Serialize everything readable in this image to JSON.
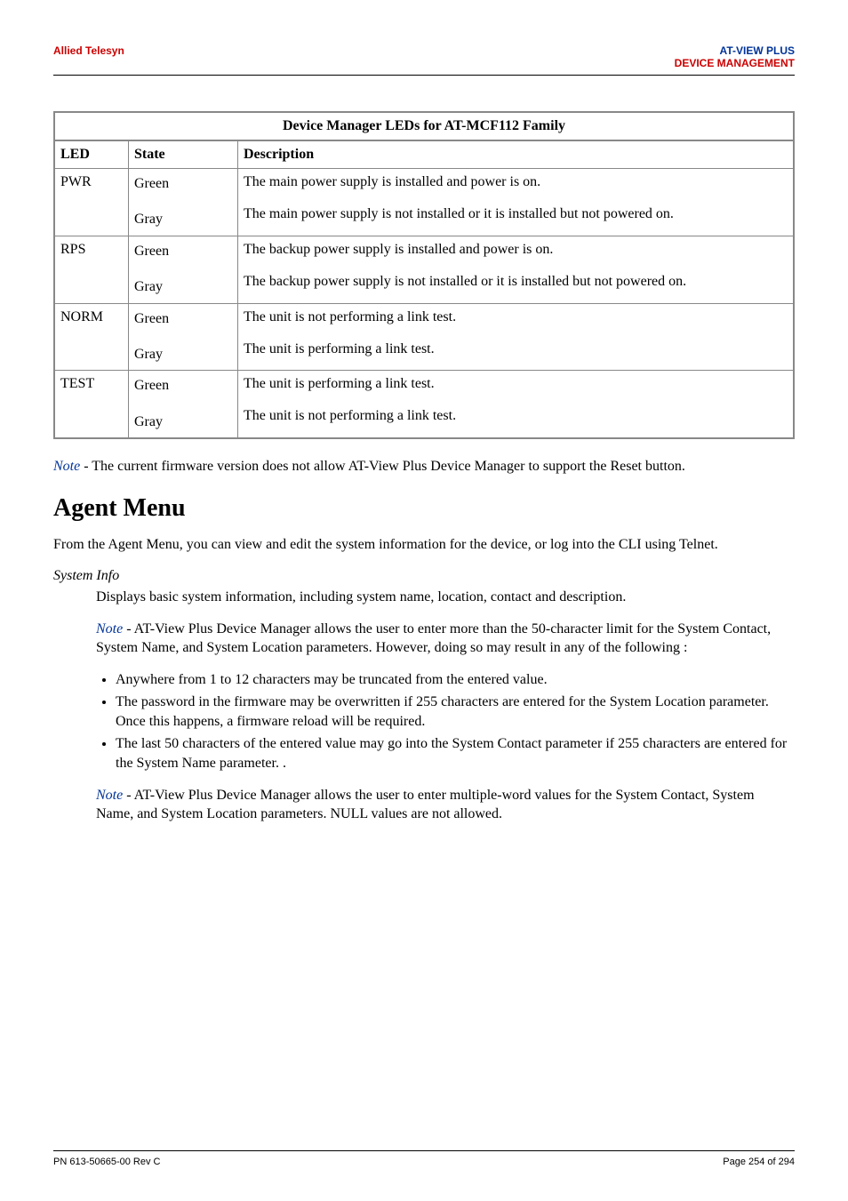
{
  "header": {
    "left": "Allied Telesyn",
    "right_line1": "AT-VIEW PLUS",
    "right_line2": "DEVICE MANAGEMENT"
  },
  "table": {
    "caption": "Device Manager LEDs for AT-MCF112 Family",
    "headers": {
      "led": "LED",
      "state": "State",
      "description": "Description"
    },
    "rows": [
      {
        "led": "PWR",
        "state1": "Green",
        "state2": "Gray",
        "desc1": "The main power supply is installed and power is on.",
        "desc2": "The main power supply is not installed or it is installed but not powered on."
      },
      {
        "led": "RPS",
        "state1": "Green",
        "state2": "Gray",
        "desc1": "The backup power supply is installed and power is on.",
        "desc2": "The backup power supply is not installed or it is installed but not powered on."
      },
      {
        "led": "NORM",
        "state1": "Green",
        "state2": "Gray",
        "desc1": "The unit is not performing a link test.",
        "desc2": "The unit is performing a link test."
      },
      {
        "led": "TEST",
        "state1": "Green",
        "state2": "Gray",
        "desc1": "The unit is performing a link test.",
        "desc2": "The unit is not performing a link test."
      }
    ]
  },
  "note1_prefix": "Note",
  "note1_rest": " - The current firmware version does not allow AT-View Plus Device Manager to support the Reset button.",
  "agent_heading": "Agent Menu",
  "agent_p1": "From the Agent Menu, you can view and edit the system information for the device, or log into the CLI using Telnet.",
  "sysinfo_label": "System Info",
  "sysinfo_p1": "Displays basic system information, including system name, location, contact and description.",
  "note2_prefix": "Note",
  "note2_rest": " - AT-View Plus Device Manager allows the user to enter more than the 50-character limit for the System Contact, System Name, and System Location parameters. However, doing so may result in any of the following :",
  "bullets": [
    "Anywhere from 1 to 12 characters may be truncated from the entered value.",
    "The password in the firmware may be overwritten if 255 characters are entered for the System Location parameter. Once this happens, a firmware reload will be required.",
    "The last 50 characters of the entered value may go into the System Contact parameter if 255 characters are entered for the System Name parameter. ."
  ],
  "note3_prefix": "Note",
  "note3_rest": " - AT-View Plus Device Manager allows the user to enter multiple-word values for the System Contact, System Name, and System Location parameters. NULL values are not allowed.",
  "footer": {
    "left": "PN 613-50665-00 Rev C",
    "right": "Page 254 of 294"
  }
}
